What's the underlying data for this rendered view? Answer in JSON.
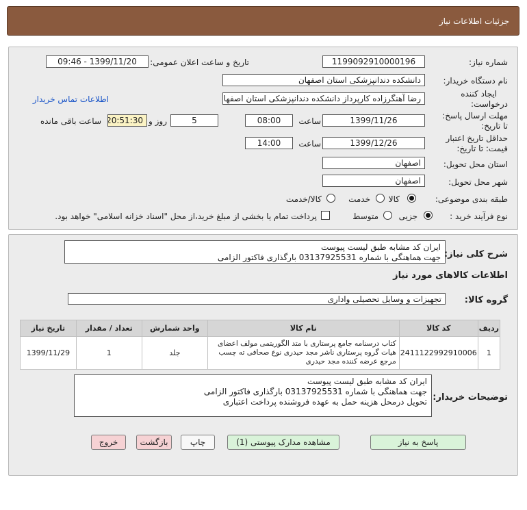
{
  "header": {
    "title": "جزئیات اطلاعات نیاز"
  },
  "form": {
    "need_number_label": "شماره نیاز:",
    "need_number": "1199092910000196",
    "announce_label": "تاریخ و ساعت اعلان عمومی:",
    "announce_value": "1399/11/20 - 09:46",
    "buyer_org_label": "نام دستگاه خریدار:",
    "buyer_org": "دانشکده دندانپزشکی استان اصفهان",
    "creator_label_1": "ایجاد کننده",
    "creator_label_2": "درخواست:",
    "creator": "رضا آهنگرزاده کارپرداز دانشکده دندانپزشکی استان اصفهان",
    "contact_link": "اطلاعات تماس خریدار",
    "reply_label_1": "مهلت ارسال پاسخ:",
    "reply_label_2": "تا تاریخ:",
    "reply_date": "1399/11/26",
    "time_label": "ساعت",
    "reply_time": "08:00",
    "days_value": "5",
    "days_label": "روز و",
    "remaining_time": "20:51:30",
    "remaining_label": "ساعت باقی مانده",
    "validity_label_1": "حداقل تاریخ اعتبار",
    "validity_label_2": "قیمت: تا تاریخ:",
    "validity_date": "1399/12/26",
    "validity_time": "14:00",
    "province_label": "استان محل تحویل:",
    "province": "اصفهان",
    "city_label": "شهر محل تحویل:",
    "city": "اصفهان",
    "category_label": "طبقه بندی موضوعی:",
    "category_goods": "کالا",
    "category_service": "خدمت",
    "category_both": "کالا/خدمت",
    "process_label": "نوع فرآیند خرید :",
    "process_partial": "جزیی",
    "process_medium": "متوسط",
    "payment_note": "پرداخت تمام یا بخشی از مبلغ خرید،از محل \"اسناد خزانه اسلامی\" خواهد بود."
  },
  "need": {
    "summary_label": "شرح کلی نیاز:",
    "summary_line1": "ایران کد مشابه طبق لیست پیوست",
    "summary_line2": "جهت هماهنگی با شماره 03137925531 بارگذاری فاکتور الزامی",
    "goods_info_title": "اطلاعات کالاهای مورد نیاز",
    "group_label": "گروه کالا:",
    "group_value": "تجهیزات و وسایل تحصیلی واداری"
  },
  "table": {
    "headers": [
      "ردیف",
      "کد کالا",
      "نام کالا",
      "واحد شمارش",
      "تعداد / مقدار",
      "تاریخ نیاز"
    ],
    "rows": [
      {
        "row": "1",
        "code": "2411122992910006",
        "name": "کتاب درسنامه جامع پرستاری با متد الگوریتمی مولف اعضای هیات گروه پرستاری ناشر مجد حیدری نوع صحافی ته چسب مرجع عرضه کننده مجد حیدری",
        "unit": "جلد",
        "qty": "1",
        "date": "1399/11/29"
      }
    ]
  },
  "buyer_notes": {
    "label": "توضیحات خریدار:",
    "line1": "ایران کد مشابه طبق لیست پیوست",
    "line2": "جهت هماهنگی با شماره 03137925531 بارگذاری فاکتور الزامی",
    "line3": "تحویل درمحل هزینه حمل به عهده فروشنده پرداخت اعتباری"
  },
  "buttons": {
    "reply": "پاسخ به نیاز",
    "attachments": "مشاهده مدارک پیوستی (1)",
    "print": "چاپ",
    "back": "بازگشت",
    "exit": "خروج"
  }
}
